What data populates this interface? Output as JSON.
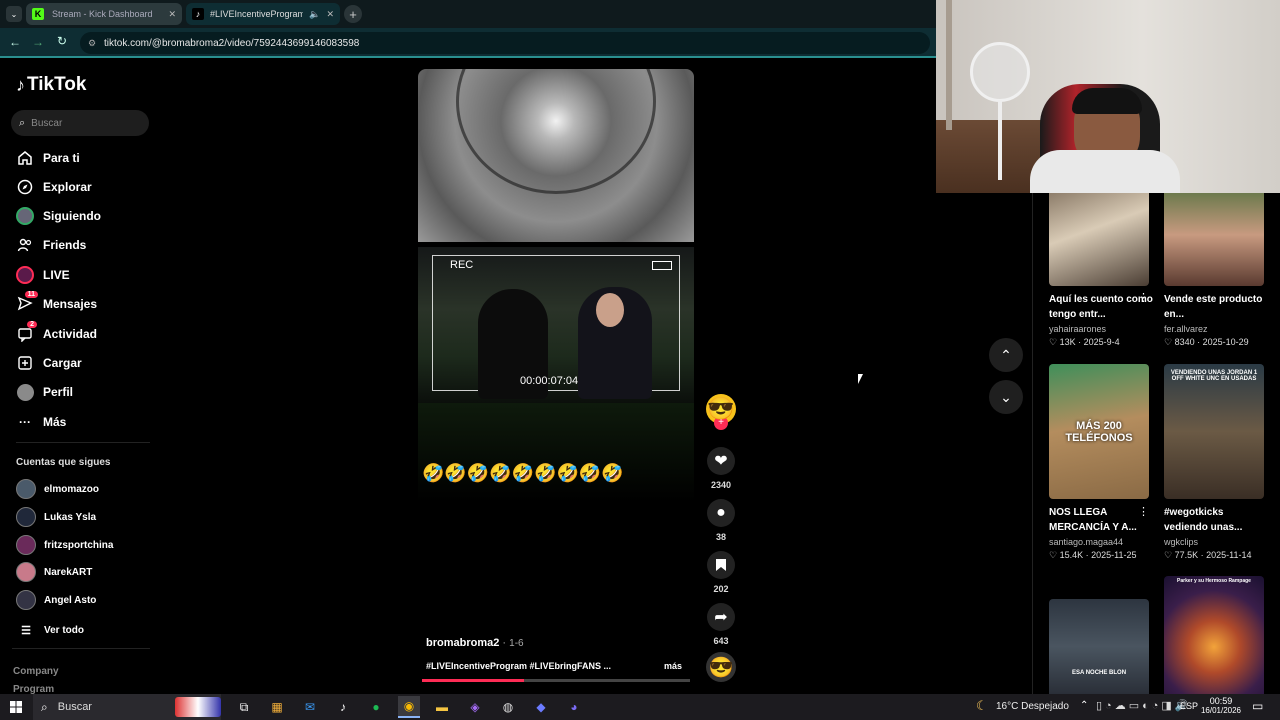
{
  "browser": {
    "tabs": [
      {
        "label": "Stream - Kick Dashboard"
      },
      {
        "label": "#LIVEIncentiveProgram #L"
      }
    ],
    "url": "tiktok.com/@bromabroma2/video/7592443699146083598"
  },
  "sidebar": {
    "logo": "TikTok",
    "search_placeholder": "Buscar",
    "nav": [
      {
        "label": "Para ti",
        "icon": "home-icon"
      },
      {
        "label": "Explorar",
        "icon": "compass-icon"
      },
      {
        "label": "Siguiendo",
        "icon": "following-avatar-icon"
      },
      {
        "label": "Friends",
        "icon": "friends-icon"
      },
      {
        "label": "LIVE",
        "icon": "live-icon"
      },
      {
        "label": "Mensajes",
        "icon": "message-icon",
        "badge": "11"
      },
      {
        "label": "Actividad",
        "icon": "activity-icon",
        "badge": "2"
      },
      {
        "label": "Cargar",
        "icon": "upload-icon"
      },
      {
        "label": "Perfil",
        "icon": "profile-icon"
      },
      {
        "label": "Más",
        "icon": "more-icon"
      }
    ],
    "following_title": "Cuentas que sigues",
    "accounts": [
      "elmomazoo",
      "Lukas Ysla",
      "fritzsportchina",
      "NarekART",
      "Angel Asto"
    ],
    "see_all": "Ver todo",
    "footer": [
      "Company",
      "Program"
    ]
  },
  "video": {
    "rec_label": "REC",
    "timecode": "00:00:07:04",
    "emoji_caption": "🤣🤣🤣🤣🤣🤣🤣🤣🤣",
    "author": "bromabroma2",
    "date": "1-6",
    "caption": "#LIVEIncentiveProgram #LIVEbringFANS ...",
    "more": "más",
    "progress": 0.38,
    "actions": {
      "likes": "2340",
      "comments": "38",
      "saves": "202",
      "shares": "643"
    }
  },
  "related": [
    {
      "title": "Aquí les cuento como tengo entr...",
      "user": "yahairaarones",
      "likes": "13K",
      "date": "2025-9-4"
    },
    {
      "title": "Vende este producto en...",
      "user": "fer.allvarez",
      "likes": "8340",
      "date": "2025-10-29"
    },
    {
      "title": "NOS LLEGA MERCANCÍA Y A...",
      "user": "santiago.magaa44",
      "likes": "15.4K",
      "date": "2025-11-25",
      "overlay": "MÁS 200 TELÉFONOS"
    },
    {
      "title": "#wegotkicks vediendo unas...",
      "user": "wgkclips",
      "likes": "77.5K",
      "date": "2025-11-14",
      "overlay": "VENDIENDO UNAS JORDAN 1 OFF WHITE UNC EN USADAS"
    },
    {
      "overlay": "ESA NOCHE BLON"
    },
    {
      "overlay": "Parker y su Hermoso Rampage"
    }
  ],
  "taskbar": {
    "search": "Buscar",
    "weather": "16°C  Despejado",
    "lang": "ESP",
    "time": "00:59",
    "date": "16/01/2026"
  },
  "colors": {
    "accent": "#fe2c55",
    "chrome": "#0e2d33"
  }
}
